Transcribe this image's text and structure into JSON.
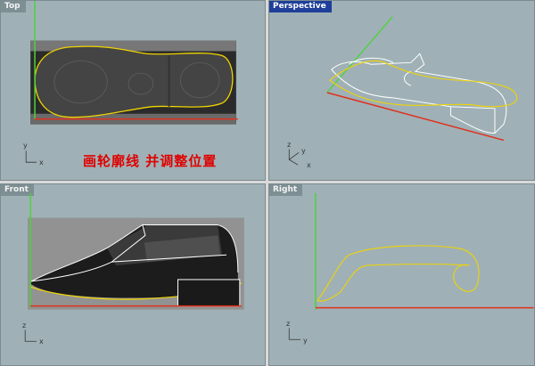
{
  "viewports": {
    "top": {
      "label": "Top",
      "active": false,
      "axis_v": "y",
      "axis_h": "x"
    },
    "perspective": {
      "label": "Perspective",
      "active": true,
      "axis_v": "z",
      "axis_h": "x",
      "axis_d": "y"
    },
    "front": {
      "label": "Front",
      "active": false,
      "axis_v": "z",
      "axis_h": "x"
    },
    "right": {
      "label": "Right",
      "active": false,
      "axis_v": "z",
      "axis_h": "y"
    }
  },
  "annotation": {
    "text": "画轮廓线 并调整位置"
  },
  "colors": {
    "viewport_bg": "#9fb1b6",
    "x_axis": "#e0301c",
    "y_axis": "#4bd33a",
    "curve": "#f0d400",
    "wire": "#ffffff",
    "active_tab": "#1f3f9a"
  }
}
